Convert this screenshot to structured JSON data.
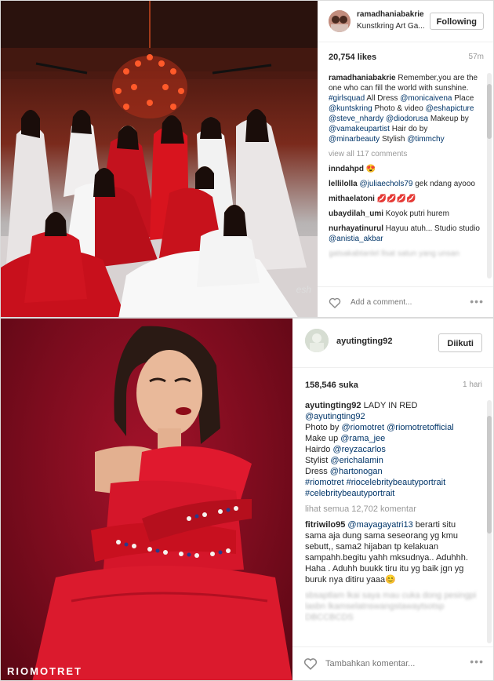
{
  "post1": {
    "username": "ramadhaniabakrie",
    "location": "Kunstkring Art Ga...",
    "follow_label": "Following",
    "likes": "20,754 likes",
    "time": "57m",
    "caption_user": "ramadhaniabakrie",
    "caption": "Remember,you are the one who can fill the world with sunshine.",
    "caption_tag1": "#girlsquad",
    "caption_all_dress": "All Dress",
    "caption_mention1": "@monicaivena",
    "caption_place": "Place",
    "caption_mention2": "@kuntskring",
    "caption_photo": "Photo & video",
    "caption_mention3": "@eshapicture",
    "caption_mention4": "@steve_nhardy",
    "caption_mention5": "@diodorusa",
    "caption_makeup": "Makeup by",
    "caption_mention6": "@vamakeupartist",
    "caption_hair": "Hair do by",
    "caption_mention7": "@minarbeauty",
    "caption_stylish": "Stylish",
    "caption_mention8": "@timmchy",
    "view_all": "view all 117 comments",
    "comments": [
      {
        "user": "inndahpd",
        "text": "😍"
      },
      {
        "user": "lellilolla",
        "mention": "@juliaechols79",
        "text": "gek ndang ayooo"
      },
      {
        "user": "mithaelatoni",
        "text": "💋💋💋💋"
      },
      {
        "user": "ubaydilah_umi",
        "text": "Koyok putri hurem"
      },
      {
        "user": "nurhayatinurul",
        "text": "Hayuu atuh... Studio studio",
        "mention": "@anistia_akbar"
      }
    ],
    "blurred": "gatsakabtanlel llsat satun yang unsan",
    "add_comment_placeholder": "Add a comment...",
    "more": "•••",
    "photo_watermark": "esh"
  },
  "post2": {
    "username": "ayutingting92",
    "follow_label": "Diikuti",
    "likes": "158,546 suka",
    "time": "1 hari",
    "caption_user": "ayutingting92",
    "caption": "LADY IN RED",
    "caption_mention1": "@ayutingting92",
    "caption_photo": "Photo by",
    "caption_mention2": "@riomotret",
    "caption_mention3": "@riomotretofficial",
    "caption_makeup": "Make up",
    "caption_mention4": "@rama_jee",
    "caption_hairdo": "Hairdo",
    "caption_mention5": "@reyzacarlos",
    "caption_stylist": "Stylist",
    "caption_mention6": "@erichalamin",
    "caption_dress": "Dress",
    "caption_mention7": "@hartonogan",
    "caption_tags": "#riomotret #riocelebritybeautyportrait #celebritybeautyportrait",
    "view_all": "lihat semua 12,702 komentar",
    "comment_user": "fitriwilo95",
    "comment_mention": "@mayagayatri13",
    "comment_text": "berarti situ sama aja dung sama seseorang yg kmu sebutt,, sama2 hijaban tp kelakuan sampahh.begitu yahh mksudnya.. Aduhhh. Haha . Aduhh buukk tiru itu yg baik jgn yg buruk nya ditiru yaaa😊",
    "blurred": "sbsaptlam lkai saya mau cuka dong pesingpi lasbn lkamselatnswangstawaytsotsp DBCCBCDS",
    "add_comment_placeholder": "Tambahkan komentar...",
    "more": "•••",
    "photo_watermark": "RIOMOTRET"
  }
}
